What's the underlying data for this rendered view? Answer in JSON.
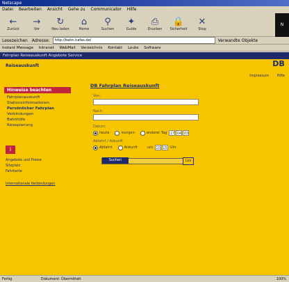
{
  "window": {
    "title": "Netscape"
  },
  "menu": {
    "items": [
      "Datei",
      "Bearbeiten",
      "Ansicht",
      "Gehe zu",
      "Communicator",
      "Hilfe"
    ]
  },
  "toolbar": {
    "buttons": [
      {
        "label": "Zurück",
        "icon": "back-arrow-icon",
        "glyph": "←"
      },
      {
        "label": "Vor",
        "icon": "forward-arrow-icon",
        "glyph": "→"
      },
      {
        "label": "Neu laden",
        "icon": "reload-icon",
        "glyph": "↻"
      },
      {
        "label": "Home",
        "icon": "home-icon",
        "glyph": "⌂"
      },
      {
        "label": "Suchen",
        "icon": "search-icon",
        "glyph": "⚲"
      },
      {
        "label": "Guide",
        "icon": "guide-icon",
        "glyph": "✦"
      },
      {
        "label": "Drucken",
        "icon": "print-icon",
        "glyph": "⎙"
      },
      {
        "label": "Sicherheit",
        "icon": "lock-icon",
        "glyph": "🔒"
      },
      {
        "label": "Stop",
        "icon": "stop-icon",
        "glyph": "✕"
      }
    ],
    "brand": "N"
  },
  "address": {
    "prefix": "Lesezeichen",
    "label": "Adresse:",
    "value": "http://bahn.hafas.de/",
    "related": "Verwandte Objekte"
  },
  "links": {
    "items": [
      "Instant Message",
      "Intranet",
      "WebMail",
      "Verzeichnis",
      "Kontakt",
      "Leute",
      "Software"
    ]
  },
  "page": {
    "topnav": "Fahrplan  Reiseauskunft  Angebote  Service",
    "heading": "Reiseauskunft",
    "logo": "DB",
    "header_links": [
      "Impressum",
      "Hilfe"
    ]
  },
  "sidebar": {
    "active": "Hinweise beachten",
    "items": [
      {
        "label": "Fahrplanauskunft",
        "sub": false
      },
      {
        "label": "Stationsinformationen",
        "sub": false
      },
      {
        "label": "Persönlicher Fahrplan",
        "sub": true
      },
      {
        "label": "Verbindungen",
        "sub": false
      },
      {
        "label": "Bahnhöfe",
        "sub": false
      },
      {
        "label": "Reiseplanung",
        "sub": false
      }
    ],
    "notes": [
      "Angebote und Preise",
      "Sitzplatz",
      "Fahrkarte"
    ],
    "link": "Internationale Verbindungen"
  },
  "form": {
    "title": "DB Fahrplan Reiseauskunft",
    "from_label": "Von:",
    "to_label": "Nach:",
    "date_label": "Datum:",
    "date_opts": [
      "heute",
      "morgen",
      "anderer Tag"
    ],
    "date_values": [
      "17",
      "04",
      "03"
    ],
    "options_label": "Abfahrt / Ankunft",
    "time_opts": [
      "Abfahrt",
      "Ankunft"
    ],
    "time_label": "um",
    "time_values": [
      "10",
      "15"
    ],
    "time_unit": "Uhr",
    "submit": "Suchen",
    "go": "Los"
  },
  "status": {
    "left": "Fertig",
    "center": "Dokument: Übermittelt",
    "right": "100%"
  }
}
